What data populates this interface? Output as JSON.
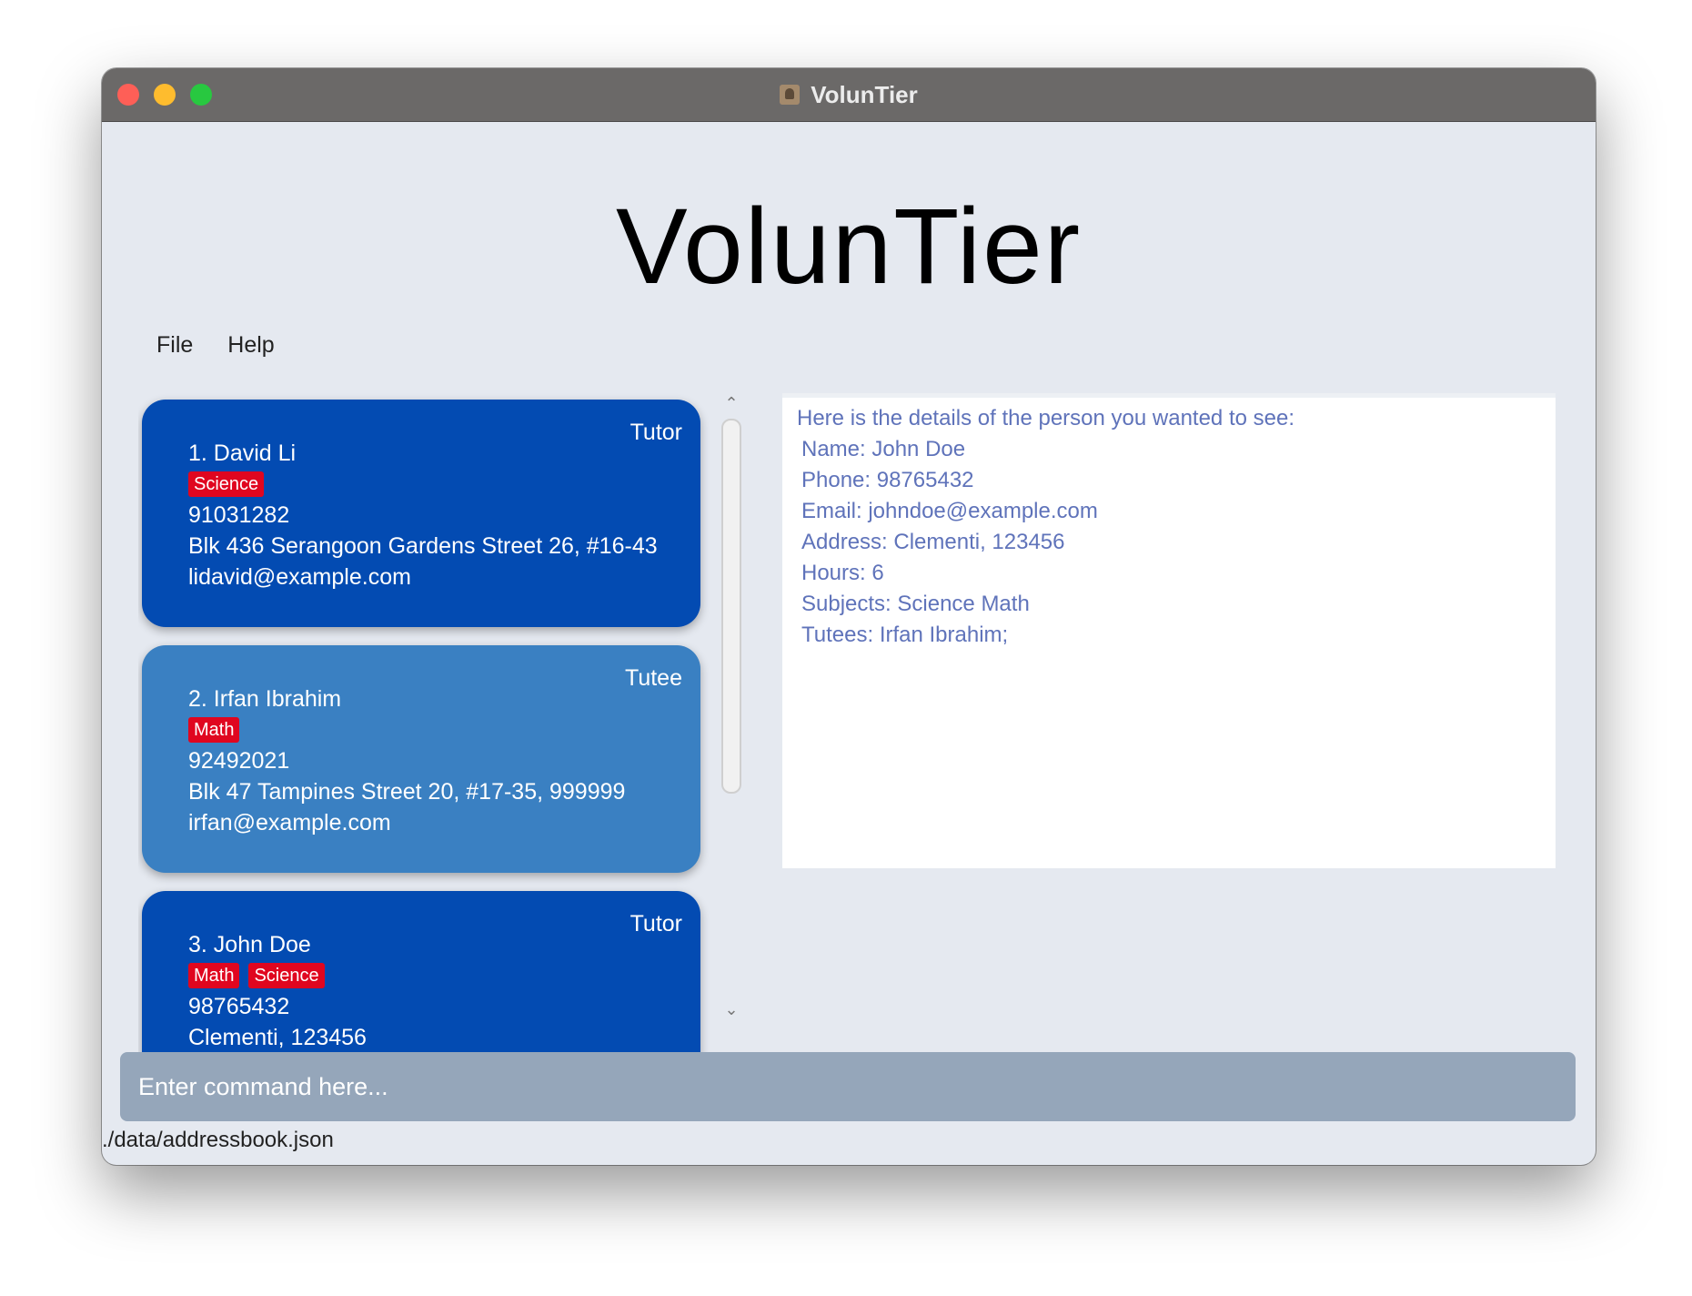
{
  "window": {
    "title": "VolunTier"
  },
  "app_header": "VolunTier",
  "menu": {
    "file": "File",
    "help": "Help"
  },
  "persons": [
    {
      "role": "Tutor",
      "title": "1. David Li",
      "tags": [
        "Science"
      ],
      "phone": "91031282",
      "address": "Blk 436 Serangoon Gardens Street 26, #16-43",
      "email": "lidavid@example.com"
    },
    {
      "role": "Tutee",
      "title": "2. Irfan Ibrahim",
      "tags": [
        "Math"
      ],
      "phone": "92492021",
      "address": "Blk 47 Tampines Street 20, #17-35, 999999",
      "email": "irfan@example.com"
    },
    {
      "role": "Tutor",
      "title": "3. John Doe",
      "tags": [
        "Math",
        "Science"
      ],
      "phone": "98765432",
      "address": "Clementi, 123456",
      "email": ""
    }
  ],
  "details": {
    "heading": "Here is the details of the person you wanted to see:",
    "name": "Name: John Doe",
    "phone": "Phone: 98765432",
    "email": "Email: johndoe@example.com",
    "address": "Address: Clementi, 123456",
    "hours": "Hours: 6",
    "subjects": "Subjects: Science Math",
    "tutees": "Tutees: Irfan Ibrahim;"
  },
  "command": {
    "placeholder": "Enter command here..."
  },
  "status": {
    "path": "./data/addressbook.json"
  },
  "icons": {
    "scroll_up": "chevron-up-icon",
    "scroll_down": "chevron-down-icon",
    "app": "contacts-app-icon"
  },
  "colors": {
    "tutor_card": "#034bb2",
    "tutee_card": "#3a80c2",
    "tag": "#e0061f",
    "detail_text": "#5f73ba",
    "command_bg": "#95a6ba"
  }
}
